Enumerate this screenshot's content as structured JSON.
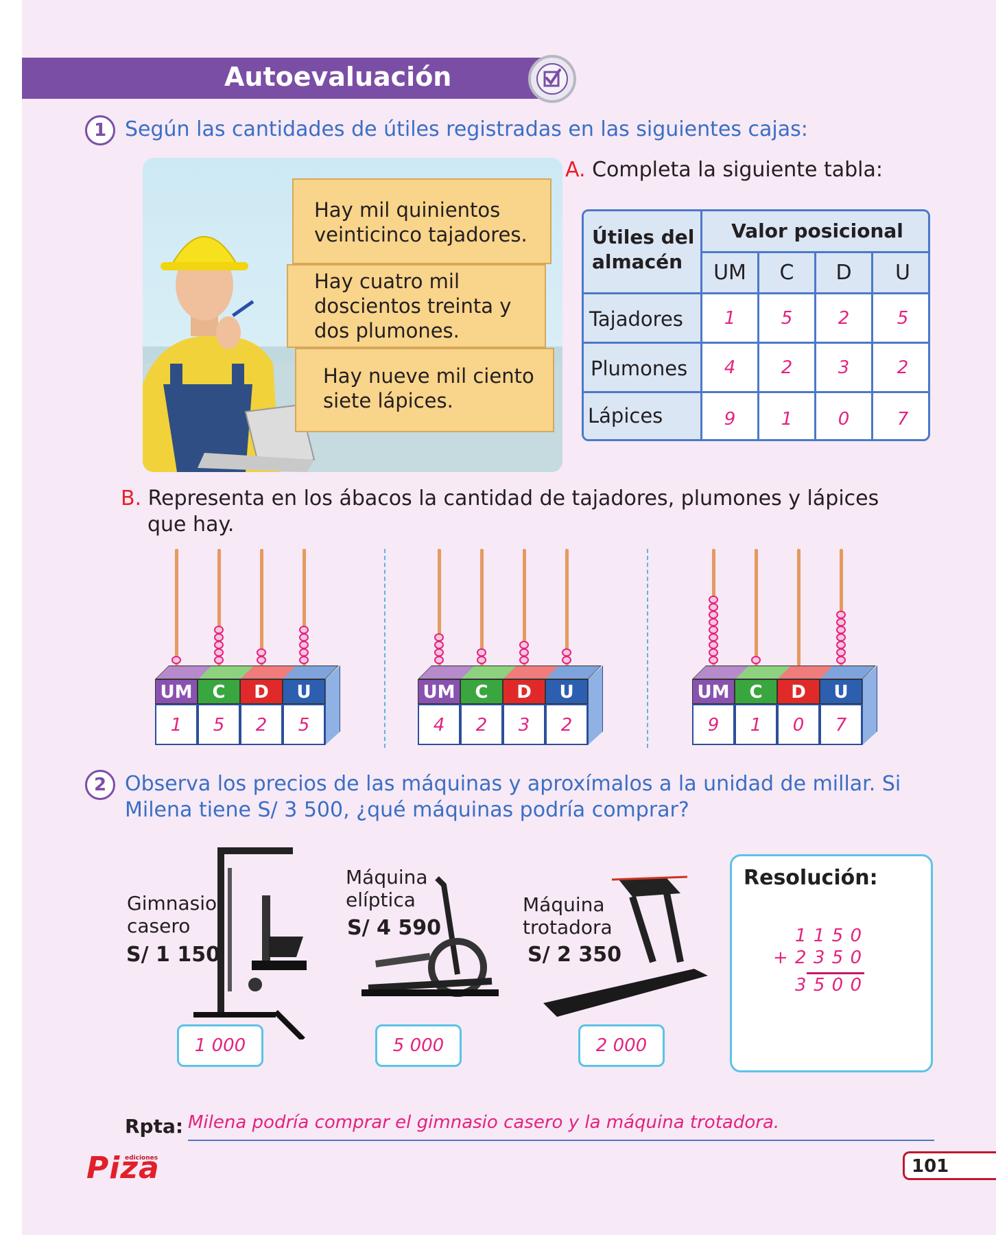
{
  "header": {
    "title": "Autoevaluación",
    "check_icon": "checkbox-icon"
  },
  "q1": {
    "number": "1",
    "text": "Según las cantidades de útiles registradas en las siguientes cajas:",
    "boxes": [
      "Hay mil quinientos veinticinco tajadores.",
      "Hay cuatro mil doscientos treinta y dos plumones.",
      "Hay nueve mil ciento siete lápices."
    ],
    "partA": {
      "letter": "A.",
      "text": "Completa la siguiente tabla:"
    },
    "table": {
      "row_header": "Útiles del almacén",
      "group_header": "Valor posicional",
      "columns": [
        "UM",
        "C",
        "D",
        "U"
      ],
      "rows": [
        {
          "name": "Tajadores",
          "values": [
            "1",
            "5",
            "2",
            "5"
          ]
        },
        {
          "name": "Plumones",
          "values": [
            "4",
            "2",
            "3",
            "2"
          ]
        },
        {
          "name": "Lápices",
          "values": [
            "9",
            "1",
            "0",
            "7"
          ]
        }
      ]
    },
    "partB": {
      "letter": "B.",
      "text_line1": "Representa en los ábacos la cantidad de tajadores, plumones y lápices",
      "text_line2": "que hay."
    },
    "abacus_labels": [
      "UM",
      "C",
      "D",
      "U"
    ],
    "abacus_colors": [
      "#8a52b0",
      "#3aa63f",
      "#e02a2a",
      "#2d5fb0"
    ],
    "abacuses": [
      {
        "digits": [
          1,
          5,
          2,
          5
        ],
        "values": [
          "1",
          "5",
          "2",
          "5"
        ]
      },
      {
        "digits": [
          4,
          2,
          3,
          2
        ],
        "values": [
          "4",
          "2",
          "3",
          "2"
        ]
      },
      {
        "digits": [
          9,
          1,
          0,
          7
        ],
        "values": [
          "9",
          "1",
          "0",
          "7"
        ]
      }
    ]
  },
  "q2": {
    "number": "2",
    "text_line1": "Observa los precios de las máquinas y aproxímalos a la unidad de millar. Si",
    "text_line2": "Milena tiene S/ 3 500, ¿qué máquinas podría comprar?",
    "machines": [
      {
        "name_line1": "Gimnasio",
        "name_line2": "casero",
        "price": "S/ 1 150",
        "approx": "1 000"
      },
      {
        "name_line1": "Máquina",
        "name_line2": "elíptica",
        "price": "S/ 4 590",
        "approx": "5 000"
      },
      {
        "name_line1": "Máquina",
        "name_line2": "trotadora",
        "price": "S/ 2 350",
        "approx": "2 000"
      }
    ],
    "resolution": {
      "title": "Resolución:",
      "line1": "1 1 5 0",
      "line2": "+ 2 3 5 0",
      "result": "3 5 0 0"
    },
    "answer_label": "Rpta:",
    "answer": "Milena podría comprar el gimnasio casero y la máquina trotadora."
  },
  "footer": {
    "logo_small": "ediciones",
    "logo": "Piza",
    "page_number": "101"
  }
}
